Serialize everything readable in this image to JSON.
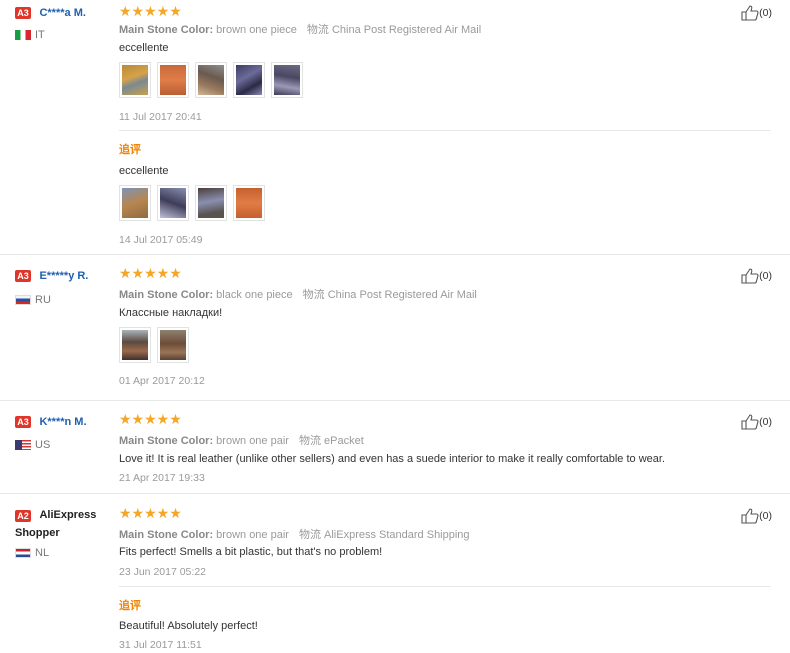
{
  "reviews": [
    {
      "level": "A3",
      "level_color": "#e0352b",
      "user": "C****a M.",
      "country": "IT",
      "flag": "it",
      "stars": "★★★★★",
      "attr_label": "Main Stone Color:",
      "attr_value": "brown one piece",
      "ship_label": "物流",
      "ship_value": "China Post Registered Air Mail",
      "text": "eccellente",
      "date": "11 Jul 2017 20:41",
      "helpful": "(0)",
      "followup": {
        "label": "追评",
        "text": "eccellente",
        "date": "14 Jul 2017 05:49"
      }
    },
    {
      "level": "A3",
      "level_color": "#e0352b",
      "user": "E*****y R.",
      "country": "RU",
      "flag": "ru",
      "stars": "★★★★★",
      "attr_label": "Main Stone Color:",
      "attr_value": "black one piece",
      "ship_label": "物流",
      "ship_value": "China Post Registered Air Mail",
      "text": "Классные накладки!",
      "date": "01 Apr 2017 20:12",
      "helpful": "(0)"
    },
    {
      "level": "A3",
      "level_color": "#e0352b",
      "user": "K****n M.",
      "country": "US",
      "flag": "us",
      "stars": "★★★★★",
      "attr_label": "Main Stone Color:",
      "attr_value": "brown one pair",
      "ship_label": "物流",
      "ship_value": "ePacket",
      "text": "Love it! It is real leather (unlike other sellers) and even has a suede interior to make it really comfortable to wear.",
      "date": "21 Apr 2017 19:33",
      "helpful": "(0)"
    },
    {
      "level": "A2",
      "level_color": "#e0352b",
      "user": "AliExpress Shopper",
      "country": "NL",
      "flag": "nl",
      "stars": "★★★★★",
      "attr_label": "Main Stone Color:",
      "attr_value": "brown one pair",
      "ship_label": "物流",
      "ship_value": "AliExpress Standard Shipping",
      "text": "Fits perfect! Smells a bit plastic, but that's no problem!",
      "date": "23 Jun 2017 05:22",
      "helpful": "(0)",
      "followup": {
        "label": "追评",
        "text": "Beautiful! Absolutely perfect!",
        "date": "31 Jul 2017 11:51"
      }
    }
  ],
  "icons": {
    "helpful": "thumbs-up-icon"
  }
}
